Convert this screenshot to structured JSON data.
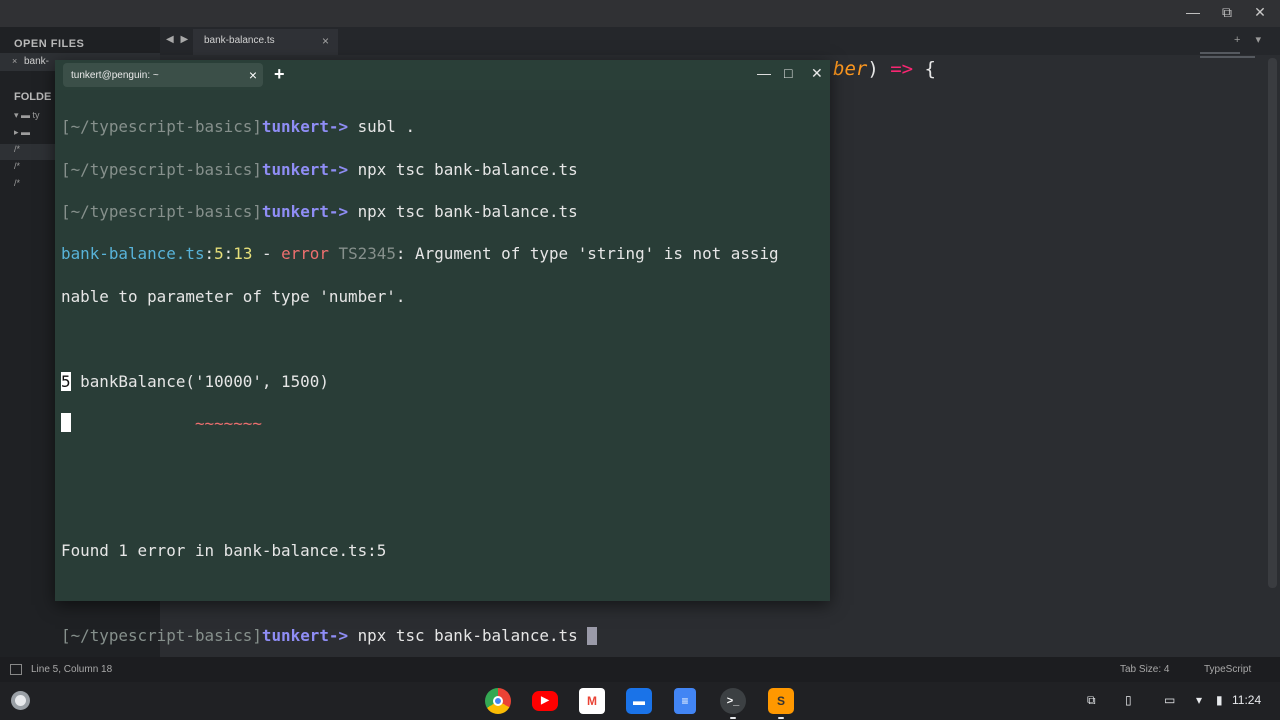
{
  "editor": {
    "window_controls": {
      "minimize": "—",
      "maximize": "⧉",
      "close": "✕"
    },
    "tab_nav": "◀ ▶",
    "active_tab": {
      "label": "bank-balance.ts",
      "close": "×"
    },
    "tab_extras": "+ ▾",
    "sidebar": {
      "open_files_heading": "OPEN FILES",
      "open_file": "bank-",
      "open_file_close": "×",
      "folders_heading": "FOLDE",
      "tree": [
        {
          "text": "▾ ▬ ty"
        },
        {
          "text": "  ▸ ▬"
        },
        {
          "text": "      /*"
        },
        {
          "text": "      /*"
        },
        {
          "text": "      /*"
        }
      ]
    },
    "code_fragment": {
      "param": "ber",
      "middle": ") ",
      "arrow": "=>",
      "end": " {"
    },
    "status": {
      "position": "Line 5, Column 18",
      "tab_size": "Tab Size: 4",
      "language": "TypeScript"
    }
  },
  "terminal": {
    "tab_title": "tunkert@penguin: ~",
    "tab_close": "×",
    "new_tab": "+",
    "controls": {
      "minimize": "—",
      "maximize": "□",
      "close": "✕"
    },
    "prompt": {
      "path": "[~/typescript-basics]",
      "user": "tunkert",
      "arrow": "-> "
    },
    "commands": [
      "subl .",
      "npx tsc bank-balance.ts",
      "npx tsc bank-balance.ts"
    ],
    "error": {
      "file": "bank-balance.ts",
      "sep1": ":",
      "line": "5",
      "sep2": ":",
      "col": "13",
      "dash": " - ",
      "word": "error",
      "code": " TS2345",
      "msg1": ": Argument of type 'string' is not assig",
      "msg2": "nable to parameter of type 'number'."
    },
    "snippet": {
      "line_no": "5",
      "code": " bankBalance('10000', 1500)",
      "squiggle": "~~~~~~~"
    },
    "found": "Found 1 error in bank-balance.ts:5",
    "last_command": "npx tsc bank-balance.ts "
  },
  "shelf": {
    "apps": [
      {
        "name": "Chrome",
        "glyph": ""
      },
      {
        "name": "YouTube",
        "glyph": "▶"
      },
      {
        "name": "Gmail",
        "glyph": "M"
      },
      {
        "name": "Files",
        "glyph": "▬"
      },
      {
        "name": "Docs",
        "glyph": "≡"
      },
      {
        "name": "Terminal",
        "glyph": ">_"
      },
      {
        "name": "Sublime Text",
        "glyph": "S"
      }
    ],
    "tray": {
      "screen_capture": "⧉",
      "phone": "▯",
      "cast": "▭",
      "wifi": "▾",
      "battery": "▮"
    },
    "clock": "11:24"
  },
  "colors": {
    "terminal_bg": "#293d37",
    "prompt_user": "#8f8df5",
    "filename": "#58b3d9",
    "error": "#ee6f6f",
    "code": "#7fd7ee"
  }
}
